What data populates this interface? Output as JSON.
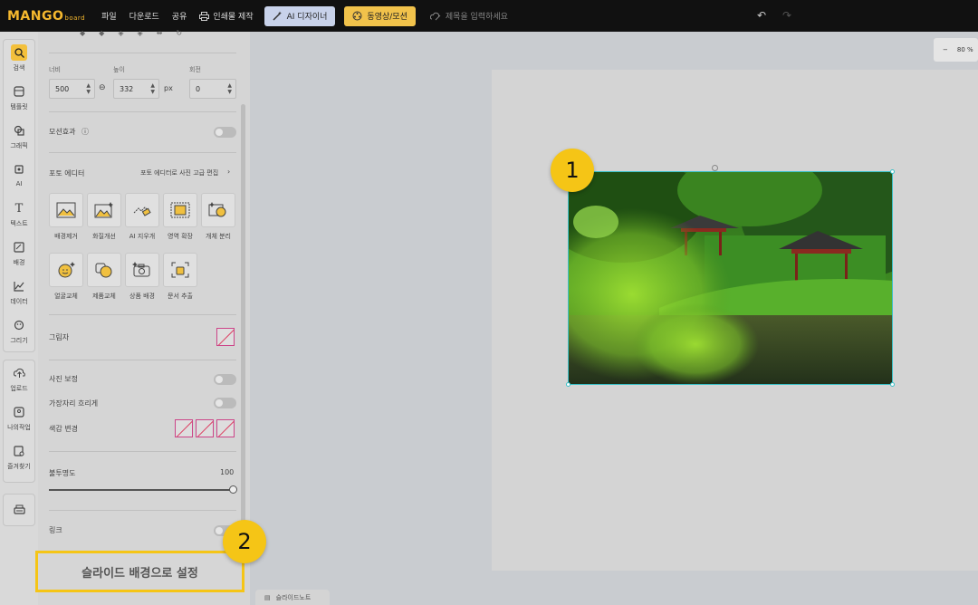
{
  "topbar": {
    "logo": "MANGO",
    "logo_sub": "board",
    "menu": [
      "파일",
      "다운로드",
      "공유"
    ],
    "print_label": "인쇄물 제작",
    "ai_designer": "AI 디자이너",
    "video_motion": "동영상/모션",
    "title_placeholder": "제목을 입력하세요"
  },
  "sidebar": {
    "items": [
      {
        "label": "검색",
        "icon": "search-icon",
        "active": true
      },
      {
        "label": "템플릿",
        "icon": "template-icon"
      },
      {
        "label": "그래픽",
        "icon": "graphic-icon"
      },
      {
        "label": "AI",
        "icon": "ai-icon"
      },
      {
        "label": "텍스트",
        "icon": "text-icon"
      },
      {
        "label": "배경",
        "icon": "background-icon"
      },
      {
        "label": "데이터",
        "icon": "chart-icon"
      },
      {
        "label": "그리기",
        "icon": "draw-icon"
      }
    ],
    "items2": [
      {
        "label": "업로드",
        "icon": "upload-icon"
      },
      {
        "label": "나의작업",
        "icon": "my-work-icon"
      },
      {
        "label": "즐겨찾기",
        "icon": "favorites-icon"
      }
    ]
  },
  "panel": {
    "width_label": "너비",
    "height_label": "높이",
    "rotation_label": "회전",
    "width_value": "500",
    "height_value": "332",
    "unit": "px",
    "rotation_value": "0",
    "motion_label": "모션효과",
    "photo_editor_label": "포토 에디터",
    "photo_editor_link": "포토 에디터로 사진 고급 편집",
    "tools": [
      "배경제거",
      "화질개선",
      "AI 지우개",
      "영역 확장",
      "개체 분리",
      "얼굴교체",
      "제품교체",
      "상품 배경",
      "문서 추출"
    ],
    "shadow_label": "그림자",
    "photo_correction": "사진 보정",
    "edge_blur": "가장자리 흐리게",
    "color_change": "색감 변경",
    "opacity_label": "불투명도",
    "opacity_value": "100",
    "link_label": "링크",
    "set_bg_button": "슬라이드 배경으로 설정"
  },
  "canvas": {
    "zoom": "80 %",
    "zoom_minus": "−",
    "notes_tab": "슬라이드노트"
  },
  "callouts": [
    "1",
    "2"
  ],
  "colors": {
    "accent": "#f5c516",
    "selection": "#3ac0c8"
  }
}
